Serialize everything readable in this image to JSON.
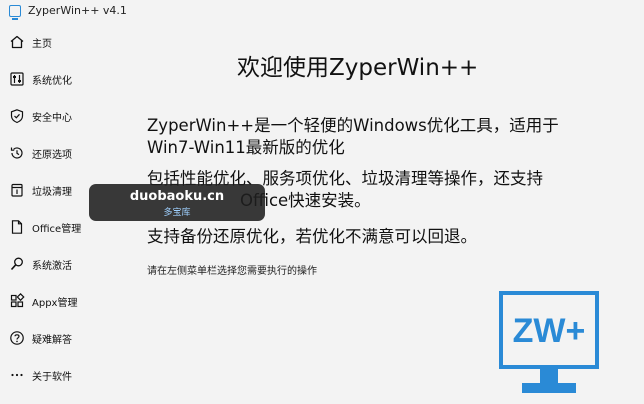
{
  "app": {
    "title": "ZyperWin++ v4.1"
  },
  "sidebar": {
    "items": [
      {
        "label": "主页",
        "icon": "home-icon"
      },
      {
        "label": "系统优化",
        "icon": "sliders-icon"
      },
      {
        "label": "安全中心",
        "icon": "shield-check-icon"
      },
      {
        "label": "还原选项",
        "icon": "restore-icon"
      },
      {
        "label": "垃圾清理",
        "icon": "trash-icon"
      },
      {
        "label": "Office管理",
        "icon": "document-icon"
      },
      {
        "label": "系统激活",
        "icon": "key-search-icon"
      },
      {
        "label": "Appx管理",
        "icon": "apps-grid-icon"
      },
      {
        "label": "疑难解答",
        "icon": "help-icon"
      },
      {
        "label": "关于软件",
        "icon": "more-icon"
      }
    ]
  },
  "main": {
    "welcome": "欢迎使用ZyperWin++",
    "lines": [
      "ZyperWin++是一个轻便的Windows优化工具，适用于",
      "Win7-Win11最新版的优化",
      "包括性能优化、服务项优化、垃圾清理等操作，还支持",
      "Office快速安装。",
      "支持备份还原优化，若优化不满意可以回退。"
    ],
    "hint": "请在左侧菜单栏选择您需要执行的操作",
    "logo_text": "ZW+"
  },
  "watermark": {
    "site": "duobaoku.cn",
    "name": "多宝库"
  },
  "colors": {
    "accent": "#2a8ad6",
    "background": "#f3f3f3"
  }
}
